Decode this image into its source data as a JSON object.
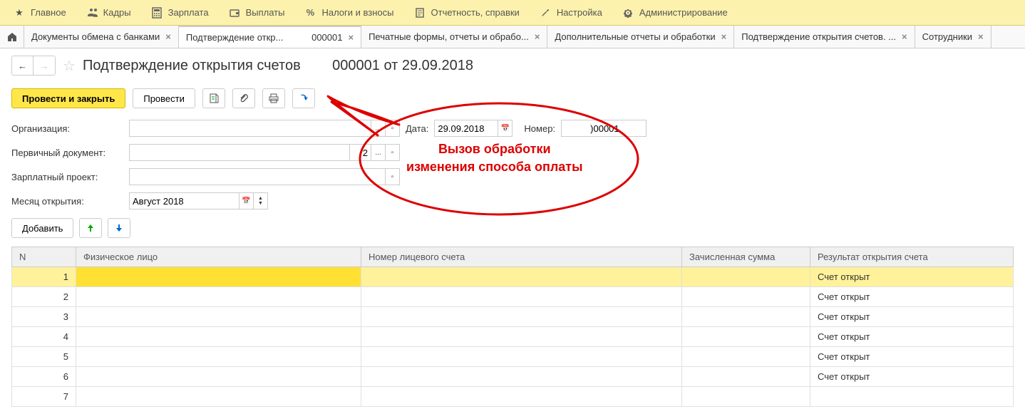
{
  "menu": [
    {
      "icon": "star",
      "label": "Главное"
    },
    {
      "icon": "people",
      "label": "Кадры"
    },
    {
      "icon": "calc",
      "label": "Зарплата"
    },
    {
      "icon": "wallet",
      "label": "Выплаты"
    },
    {
      "icon": "percent",
      "label": "Налоги и взносы"
    },
    {
      "icon": "doc",
      "label": "Отчетность, справки"
    },
    {
      "icon": "wrench",
      "label": "Настройка"
    },
    {
      "icon": "gear",
      "label": "Администрирование"
    }
  ],
  "tabs": [
    {
      "label": "Документы обмена с банками",
      "active": false
    },
    {
      "label": "Подтверждение откр...           000001",
      "active": true
    },
    {
      "label": "Печатные формы, отчеты и обрабо...",
      "active": false
    },
    {
      "label": "Дополнительные отчеты и обработки",
      "active": false
    },
    {
      "label": "Подтверждение открытия счетов. ...",
      "active": false
    },
    {
      "label": "Сотрудники",
      "active": false
    }
  ],
  "page_title": "Подтверждение открытия счетов        000001 от 29.09.2018",
  "buttons": {
    "post_and_close": "Провести и закрыть",
    "post": "Провести",
    "add": "Добавить"
  },
  "form": {
    "org_label": "Организация:",
    "org_value": "",
    "date_label": "Дата:",
    "date_value": "29.09.2018",
    "number_label": "Номер:",
    "number_value": "          )00001",
    "primary_doc_label": "Первичный документ:",
    "primary_doc_value": "",
    "primary_doc_code": "2",
    "salary_project_label": "Зарплатный проект:",
    "salary_project_value": "",
    "open_month_label": "Месяц открытия:",
    "open_month_value": "Август 2018"
  },
  "table": {
    "headers": {
      "n": "N",
      "fiz": "Физическое лицо",
      "nomer": "Номер лицевого счета",
      "sum": "Зачисленная сумма",
      "result": "Результат открытия счета"
    },
    "rows": [
      {
        "n": "1",
        "fiz": "",
        "nomer": "",
        "sum": "",
        "result": "Счет открыт",
        "selected": true
      },
      {
        "n": "2",
        "fiz": "",
        "nomer": "",
        "sum": "",
        "result": "Счет открыт"
      },
      {
        "n": "3",
        "fiz": "",
        "nomer": "",
        "sum": "",
        "result": "Счет открыт"
      },
      {
        "n": "4",
        "fiz": "",
        "nomer": "",
        "sum": "",
        "result": "Счет открыт"
      },
      {
        "n": "5",
        "fiz": "",
        "nomer": "",
        "sum": "",
        "result": "Счет открыт"
      },
      {
        "n": "6",
        "fiz": "",
        "nomer": "",
        "sum": "",
        "result": "Счет открыт"
      },
      {
        "n": "7",
        "fiz": "",
        "nomer": "",
        "sum": "",
        "result": ""
      }
    ]
  },
  "callout": {
    "line1": "Вызов обработки",
    "line2": "изменения способа оплаты"
  }
}
